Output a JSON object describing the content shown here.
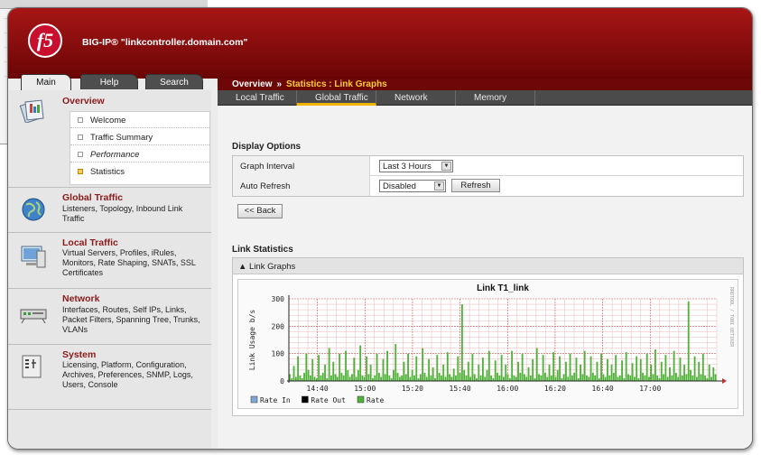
{
  "app": {
    "logo_text": "f5",
    "hostname": "BIG-IP® \"linkcontroller.domain.com\""
  },
  "tabs": [
    {
      "label": "Main",
      "active": true
    },
    {
      "label": "Help",
      "active": false
    },
    {
      "label": "Search",
      "active": false
    }
  ],
  "breadcrumb": {
    "root": "Overview",
    "sep": "»",
    "current": "Statistics : Link Graphs"
  },
  "subnav": [
    {
      "label": "Local Traffic",
      "active": false
    },
    {
      "label": "Global Traffic",
      "active": true
    },
    {
      "label": "Network",
      "active": false
    },
    {
      "label": "Memory",
      "active": false
    }
  ],
  "sidebar": {
    "overview": {
      "title": "Overview",
      "items": [
        {
          "label": "Welcome",
          "active": false
        },
        {
          "label": "Traffic Summary",
          "active": false
        },
        {
          "label": "Performance",
          "active": false
        },
        {
          "label": "Statistics",
          "active": true
        }
      ]
    },
    "sections": [
      {
        "title": "Global Traffic",
        "desc": "Listeners, Topology, Inbound Link Traffic",
        "icon": "globe-icon"
      },
      {
        "title": "Local Traffic",
        "desc": "Virtual Servers, Profiles, iRules, Monitors, Rate Shaping, SNATs, SSL Certificates",
        "icon": "monitor-icon"
      },
      {
        "title": "Network",
        "desc": "Interfaces, Routes, Self IPs, Links, Packet Filters, Spanning Tree, Trunks, VLANs",
        "icon": "router-icon"
      },
      {
        "title": "System",
        "desc": "Licensing, Platform, Configuration, Archives, Preferences, SNMP, Logs, Users, Console",
        "icon": "system-icon"
      }
    ]
  },
  "display_options": {
    "heading": "Display Options",
    "graph_interval_label": "Graph Interval",
    "graph_interval_value": "Last 3 Hours",
    "auto_refresh_label": "Auto Refresh",
    "auto_refresh_value": "Disabled",
    "refresh_button": "Refresh",
    "back_button": "<< Back"
  },
  "link_stats": {
    "heading": "Link Statistics",
    "panel_label": "▲ Link Graphs"
  },
  "colors": {
    "header_red": "#8b0a0a",
    "accent_gold": "#ffcc33",
    "section_title": "#8b1a1a",
    "rate_green": "#4fb33a",
    "rate_in": "#7fa7d3",
    "rate_out": "#000000"
  },
  "chart_data": {
    "type": "bar",
    "title": "Link T1_link",
    "ylabel": "Link Usage b/s",
    "xlabel": "",
    "ylim": [
      0,
      300
    ],
    "yticks": [
      0,
      100,
      200,
      300
    ],
    "xticks": [
      "14:40",
      "15:00",
      "15:20",
      "15:40",
      "16:00",
      "16:20",
      "16:40",
      "17:00"
    ],
    "xrange": [
      "14:28",
      "17:28"
    ],
    "grid": true,
    "watermark": "RRDTOOL / TOBI OETIKER",
    "legend": [
      {
        "name": "Rate In",
        "color": "#7fa7d3"
      },
      {
        "name": "Rate Out",
        "color": "#000000"
      },
      {
        "name": "Rate",
        "color": "#4fb33a"
      }
    ],
    "series": [
      {
        "name": "Rate",
        "values": [
          25,
          10,
          55,
          15,
          90,
          20,
          10,
          30,
          100,
          40,
          20,
          80,
          15,
          10,
          95,
          20,
          30,
          60,
          10,
          120,
          20,
          70,
          25,
          15,
          100,
          30,
          20,
          110,
          40,
          15,
          25,
          85,
          15,
          40,
          130,
          20,
          15,
          90,
          25,
          60,
          10,
          20,
          100,
          30,
          15,
          80,
          25,
          110,
          20,
          10,
          40,
          135,
          30,
          15,
          20,
          70,
          25,
          100,
          15,
          40,
          20,
          90,
          10,
          25,
          120,
          30,
          15,
          80,
          20,
          50,
          10,
          95,
          30,
          20,
          60,
          15,
          105,
          25,
          15,
          45,
          20,
          90,
          30,
          280,
          40,
          20,
          70,
          15,
          100,
          25,
          10,
          60,
          20,
          85,
          15,
          40,
          110,
          20,
          10,
          75,
          30,
          20,
          95,
          15,
          60,
          25,
          10,
          110,
          20,
          15,
          70,
          30,
          100,
          25,
          15,
          50,
          20,
          80,
          10,
          120,
          25,
          20,
          95,
          30,
          15,
          60,
          20,
          105,
          15,
          40,
          90,
          10,
          25,
          70,
          15,
          100,
          20,
          30,
          85,
          10,
          60,
          25,
          110,
          20,
          15,
          90,
          30,
          20,
          70,
          10,
          100,
          25,
          15,
          80,
          20,
          60,
          30,
          95,
          15,
          20,
          75,
          10,
          105,
          25,
          20,
          65,
          15,
          90,
          10,
          80,
          30,
          20,
          100,
          15,
          60,
          25,
          115,
          20,
          10,
          70,
          25,
          95,
          15,
          50,
          20,
          110,
          30,
          15,
          85,
          20,
          60,
          25,
          290,
          40,
          20,
          90,
          15,
          70,
          25,
          100,
          20,
          10,
          60,
          15,
          50,
          25
        ]
      }
    ]
  }
}
